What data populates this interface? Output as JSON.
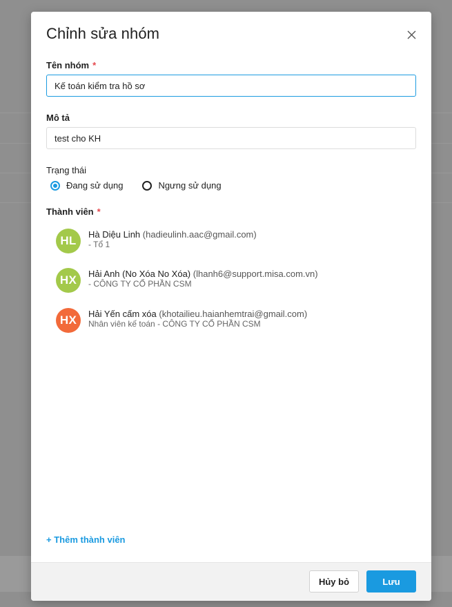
{
  "dialog": {
    "title": "Chỉnh sửa nhóm"
  },
  "form": {
    "group_name": {
      "label": "Tên nhóm",
      "required_mark": "*",
      "value": "Kế toán kiểm tra hồ sơ"
    },
    "description": {
      "label": "Mô tả",
      "value": "test cho KH"
    },
    "status": {
      "label": "Trạng thái",
      "options": [
        {
          "label": "Đang sử dụng",
          "checked": true
        },
        {
          "label": "Ngưng sử dụng",
          "checked": false
        }
      ]
    },
    "members": {
      "label": "Thành viên",
      "required_mark": "*",
      "items": [
        {
          "initials": "HL",
          "avatar_color": "#a3c94a",
          "name": "Hà Diệu Linh",
          "email": "(hadieulinh.aac@gmail.com)",
          "detail": "- Tổ 1"
        },
        {
          "initials": "HX",
          "avatar_color": "#a3c94a",
          "name": "Hải Anh (No Xóa No Xóa)",
          "email": "(lhanh6@support.misa.com.vn)",
          "detail": "- CÔNG TY CỔ PHẦN CSM"
        },
        {
          "initials": "HX",
          "avatar_color": "#f26a3a",
          "name": "Hải Yến cấm xóa",
          "email": "(khotailieu.haianhemtrai@gmail.com)",
          "detail": "Nhân viên kế toán - CÔNG TY CỔ PHẦN CSM"
        }
      ],
      "add_label": "+ Thêm thành viên"
    }
  },
  "footer": {
    "cancel_label": "Hủy bỏ",
    "save_label": "Lưu"
  },
  "colors": {
    "accent": "#1a9ae0",
    "required": "#e5484d",
    "overlay": "#8f8f8f"
  }
}
